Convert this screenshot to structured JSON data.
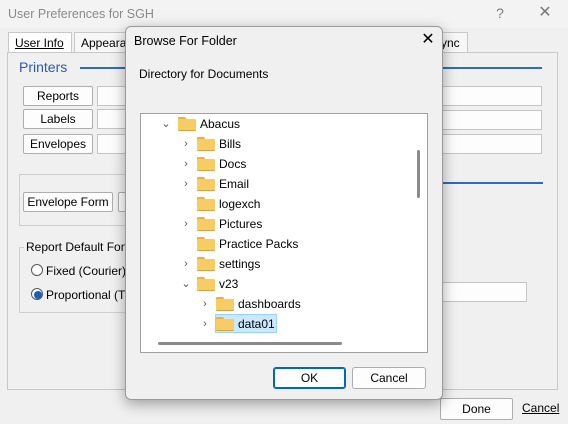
{
  "background": {
    "title": "User Preferences for SGH",
    "help_glyph": "?",
    "close_glyph": "✕",
    "tabs": [
      "User Info",
      "Appearance",
      "ync"
    ],
    "printers_heading": "Printers",
    "buttons": {
      "reports": "Reports",
      "labels": "Labels",
      "envelopes": "Envelopes",
      "envelope_form": "Envelope Form"
    },
    "report_font_label": "Report Default Font",
    "radio_fixed": "Fixed (Courier)",
    "radio_proportional": "Proportional (Times)",
    "selected_font": "proportional",
    "done": "Done",
    "cancel": "Cancel"
  },
  "dialog": {
    "title": "Browse For Folder",
    "close_glyph": "✕",
    "description": "Directory for Documents",
    "tree": [
      {
        "label": "Abacus",
        "chev": "expanded"
      },
      {
        "label": "Bills",
        "chev": "collapsed"
      },
      {
        "label": "Docs",
        "chev": "collapsed"
      },
      {
        "label": "Email",
        "chev": "collapsed"
      },
      {
        "label": "logexch",
        "chev": "none"
      },
      {
        "label": "Pictures",
        "chev": "collapsed"
      },
      {
        "label": "Practice Packs",
        "chev": "none"
      },
      {
        "label": "settings",
        "chev": "collapsed"
      },
      {
        "label": "v23",
        "chev": "expanded"
      },
      {
        "label": "dashboards",
        "chev": "collapsed"
      },
      {
        "label": "data01",
        "chev": "collapsed",
        "selected": true
      }
    ],
    "ok": "OK",
    "cancel": "Cancel",
    "colors": {
      "selection_bg": "#cce8ff",
      "folder": "#f7cc62",
      "accent": "#0067c0"
    }
  }
}
